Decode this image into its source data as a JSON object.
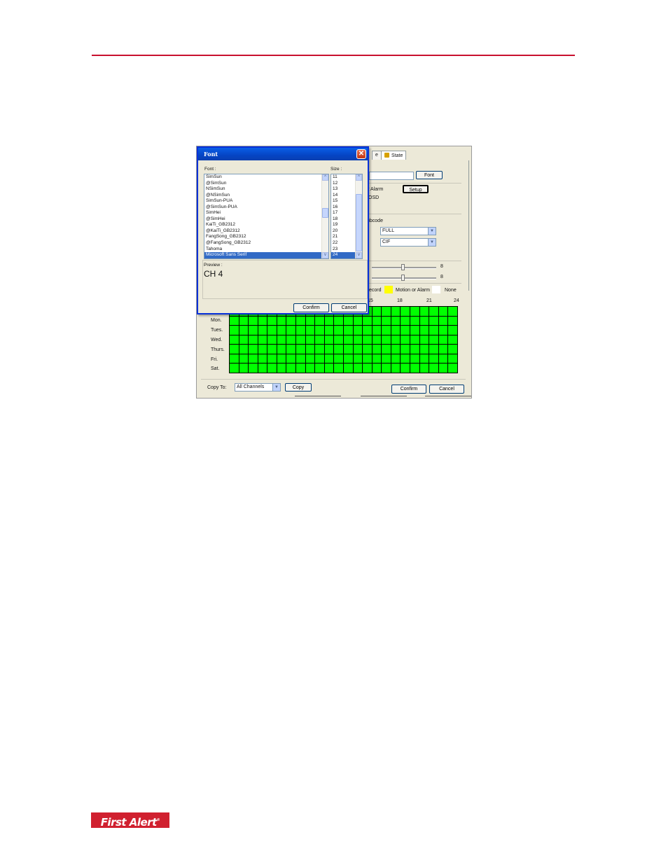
{
  "page": {
    "brand_logo": "First Alert",
    "brand_mark": "®"
  },
  "config_window": {
    "tabs": [
      {
        "label": "e"
      },
      {
        "label": "State",
        "icon": "state-icon"
      }
    ],
    "font_button": "Font",
    "alarm_label": "st Alarm",
    "setup_button": "Setup",
    "osd_label": "OSD",
    "subcode_label": "ubcode",
    "combo_1": "FULL",
    "combo_2": "CIF",
    "slider_1_value": "8",
    "slider_2_value": "8",
    "legend": {
      "record_label": "ecord",
      "motion_label": "Motion or Alarm",
      "none_label": "None",
      "colors": {
        "record": "#00ff00",
        "motion": "#ffff00",
        "none": "#ffffff"
      }
    },
    "hour_labels": [
      "15",
      "18",
      "21",
      "24"
    ],
    "days": [
      "Mon.",
      "Tues.",
      "Wed.",
      "Thurs.",
      "Fri.",
      "Sat."
    ],
    "copy_to_label": "Copy To:",
    "copy_to_value": "All Channels",
    "copy_button": "Copy",
    "confirm_button": "Confirm",
    "cancel_button": "Cancel"
  },
  "font_dialog": {
    "title": "Font",
    "font_label": "Font :",
    "size_label": "Size :",
    "fonts": [
      "SimSun",
      "@SimSun",
      "NSimSun",
      "@NSimSun",
      "SimSun-PUA",
      "@SimSun-PUA",
      "SimHei",
      "@SimHei",
      "KaiTi_GB2312",
      "@KaiTi_GB2312",
      "FangSong_GB2312",
      "@FangSong_GB2312",
      "Tahoma",
      "Microsoft Sans Serif"
    ],
    "selected_font": "Microsoft Sans Serif",
    "sizes": [
      "11",
      "12",
      "13",
      "14",
      "15",
      "16",
      "17",
      "18",
      "19",
      "20",
      "21",
      "22",
      "23",
      "24"
    ],
    "selected_size": "24",
    "preview_label": "Preview :",
    "preview_text": "CH 4",
    "confirm_button": "Confirm",
    "cancel_button": "Cancel"
  }
}
